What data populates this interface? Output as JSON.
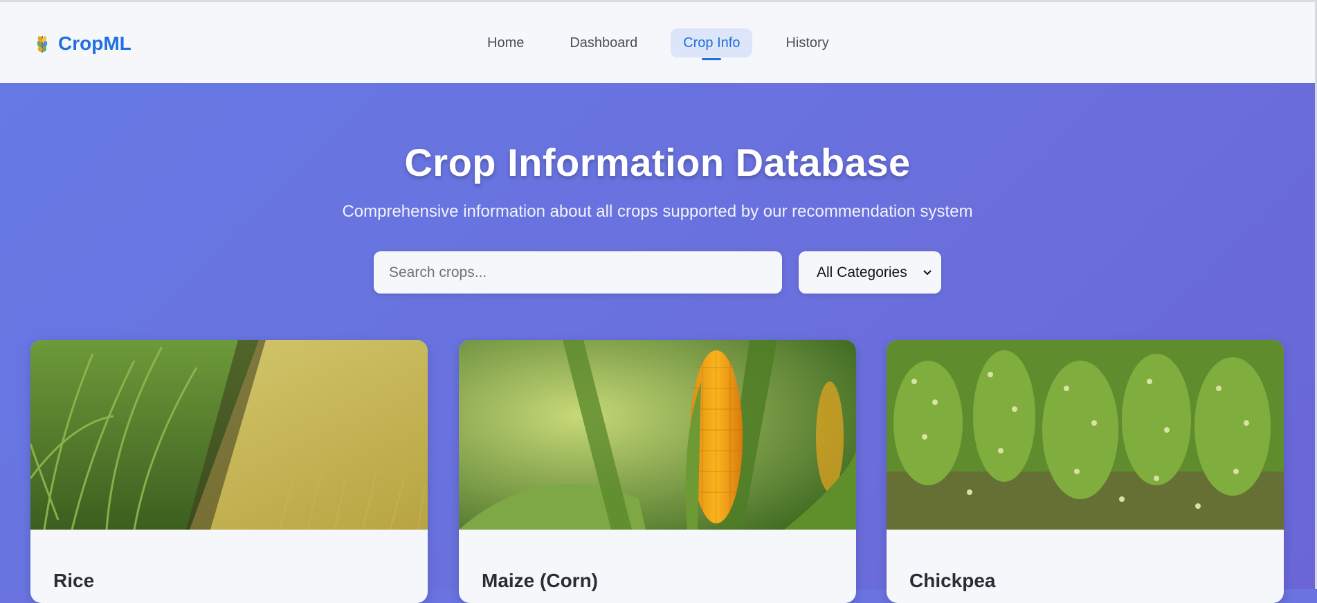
{
  "brand": {
    "name": "CropML",
    "icon": "wheat-icon"
  },
  "nav": {
    "items": [
      {
        "label": "Home",
        "active": false
      },
      {
        "label": "Dashboard",
        "active": false
      },
      {
        "label": "Crop Info",
        "active": true
      },
      {
        "label": "History",
        "active": false
      }
    ]
  },
  "hero": {
    "title": "Crop Information Database",
    "subtitle": "Comprehensive information about all crops supported by our recommendation system"
  },
  "search": {
    "placeholder": "Search crops...",
    "value": ""
  },
  "category_filter": {
    "selected": "All Categories",
    "icon": "chevron-down-icon"
  },
  "crops": [
    {
      "name": "Rice",
      "image": "rice-field-photo"
    },
    {
      "name": "Maize (Corn)",
      "image": "maize-cob-photo"
    },
    {
      "name": "Chickpea",
      "image": "chickpea-plants-photo"
    }
  ],
  "colors": {
    "accent": "#1f6fe0",
    "hero_bg": "#6a73df",
    "surface": "#f6f7fb"
  }
}
